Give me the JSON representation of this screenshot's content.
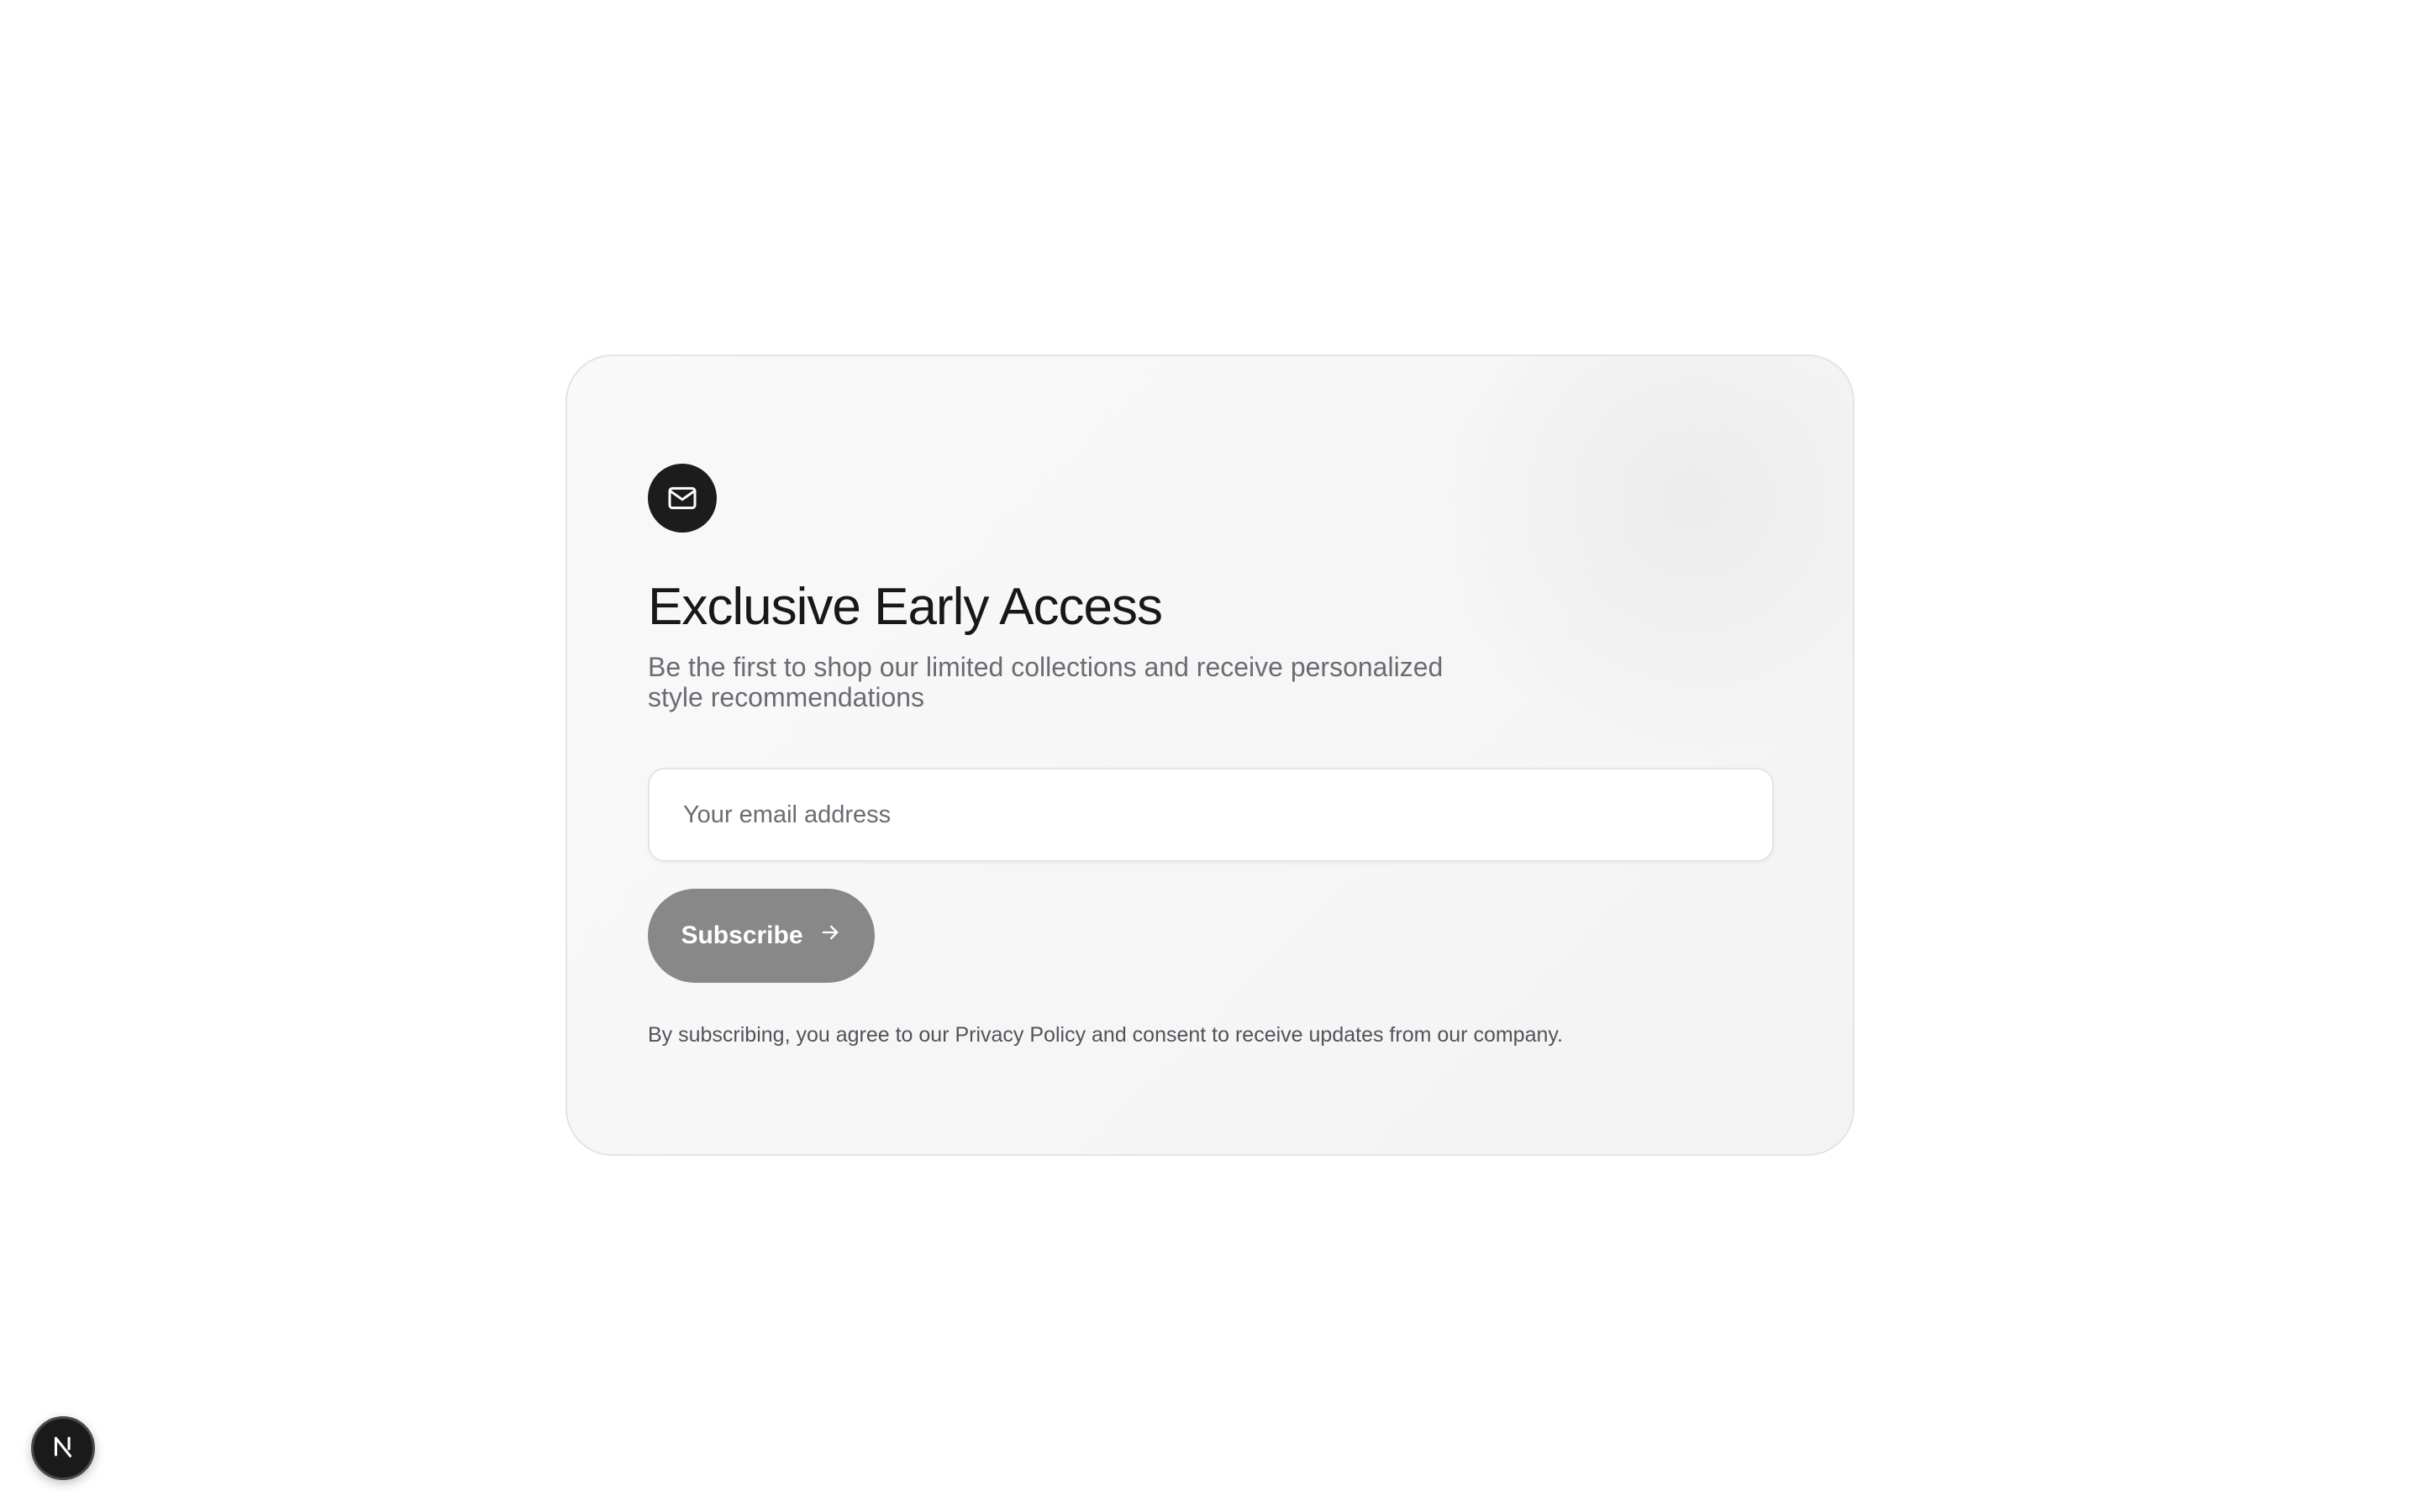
{
  "card": {
    "icon": "mail-icon",
    "title": "Exclusive Early Access",
    "subtitle": "Be the first to shop our limited collections and receive personalized style recommendations",
    "email_input": {
      "value": "",
      "placeholder": "Your email address"
    },
    "subscribe_button": {
      "label": "Subscribe",
      "icon": "arrow-right-icon"
    },
    "disclaimer": "By subscribing, you agree to our Privacy Policy and consent to receive updates from our company."
  },
  "dev_badge": {
    "icon": "nextjs-logo-icon",
    "letter": "N"
  },
  "colors": {
    "page_background": "#ffffff",
    "card_background": "#f6f6f6",
    "card_border": "#e4e4e7",
    "icon_badge": "#1c1c1c",
    "title_text": "#18181b",
    "muted_text": "#6b6b74",
    "button_background": "#888888",
    "button_text": "#ffffff"
  }
}
